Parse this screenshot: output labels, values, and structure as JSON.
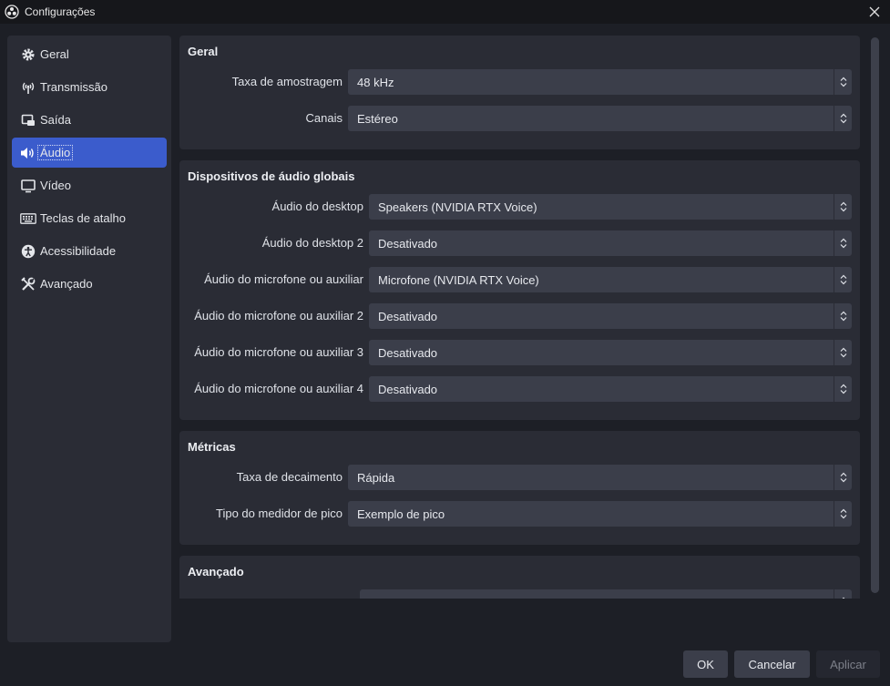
{
  "window": {
    "title": "Configurações",
    "app_icon": "obs-logo-icon",
    "close_icon": "close-icon"
  },
  "sidebar": {
    "items": [
      {
        "label": "Geral",
        "icon": "gear-icon"
      },
      {
        "label": "Transmissão",
        "icon": "antenna-icon"
      },
      {
        "label": "Saída",
        "icon": "output-icon"
      },
      {
        "label": "Áudio",
        "icon": "speaker-icon",
        "active": true
      },
      {
        "label": "Vídeo",
        "icon": "monitor-icon"
      },
      {
        "label": "Teclas de atalho",
        "icon": "keyboard-icon"
      },
      {
        "label": "Acessibilidade",
        "icon": "accessibility-icon"
      },
      {
        "label": "Avançado",
        "icon": "tools-icon"
      }
    ]
  },
  "general": {
    "title": "Geral",
    "sample_rate_label": "Taxa de amostragem",
    "sample_rate_value": "48 kHz",
    "channels_label": "Canais",
    "channels_value": "Estéreo"
  },
  "global_devices": {
    "title": "Dispositivos de áudio globais",
    "rows": [
      {
        "label": "Áudio do desktop",
        "value": "Speakers (NVIDIA RTX Voice)"
      },
      {
        "label": "Áudio do desktop 2",
        "value": "Desativado"
      },
      {
        "label": "Áudio do microfone ou auxiliar",
        "value": "Microfone (NVIDIA RTX Voice)"
      },
      {
        "label": "Áudio do microfone ou auxiliar 2",
        "value": "Desativado"
      },
      {
        "label": "Áudio do microfone ou auxiliar 3",
        "value": "Desativado"
      },
      {
        "label": "Áudio do microfone ou auxiliar 4",
        "value": "Desativado"
      }
    ]
  },
  "meters": {
    "title": "Métricas",
    "decay_label": "Taxa de decaimento",
    "decay_value": "Rápida",
    "peak_label": "Tipo do medidor de pico",
    "peak_value": "Exemplo de pico"
  },
  "advanced": {
    "title": "Avançado"
  },
  "buttons": {
    "ok": "OK",
    "cancel": "Cancelar",
    "apply": "Aplicar"
  },
  "colors": {
    "accent": "#3b5ccc",
    "background": "#1d1f26",
    "panel": "#2a2c35",
    "control": "#3b3e4a"
  }
}
